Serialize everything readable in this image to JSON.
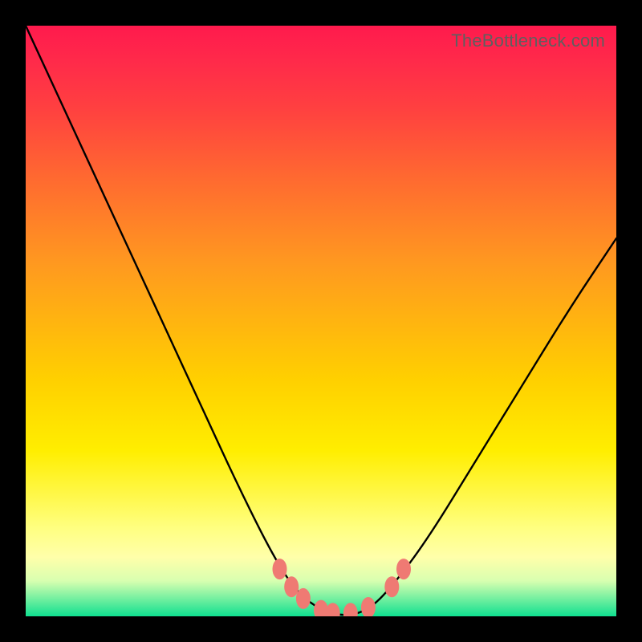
{
  "watermark": "TheBottleneck.com",
  "colors": {
    "frame": "#000000",
    "curve": "#000000",
    "marker_fill": "#ef7a73",
    "gradient_top": "#ff1a4d",
    "gradient_bottom": "#10e090"
  },
  "chart_data": {
    "type": "line",
    "title": "",
    "xlabel": "",
    "ylabel": "",
    "xlim": [
      0,
      100
    ],
    "ylim": [
      0,
      100
    ],
    "grid": false,
    "annotations": [
      "TheBottleneck.com"
    ],
    "series": [
      {
        "name": "bottleneck-curve",
        "x": [
          0,
          6,
          12,
          18,
          24,
          30,
          36,
          42,
          46,
          50,
          54,
          58,
          62,
          68,
          76,
          84,
          92,
          100
        ],
        "y": [
          100,
          87,
          74,
          61,
          48,
          35,
          22,
          10,
          4,
          1,
          0,
          1,
          5,
          13,
          26,
          39,
          52,
          64
        ]
      }
    ],
    "markers": [
      {
        "x": 43,
        "y": 8
      },
      {
        "x": 45,
        "y": 5
      },
      {
        "x": 47,
        "y": 3
      },
      {
        "x": 50,
        "y": 1
      },
      {
        "x": 52,
        "y": 0.5
      },
      {
        "x": 55,
        "y": 0.5
      },
      {
        "x": 58,
        "y": 1.5
      },
      {
        "x": 62,
        "y": 5
      },
      {
        "x": 64,
        "y": 8
      }
    ]
  }
}
